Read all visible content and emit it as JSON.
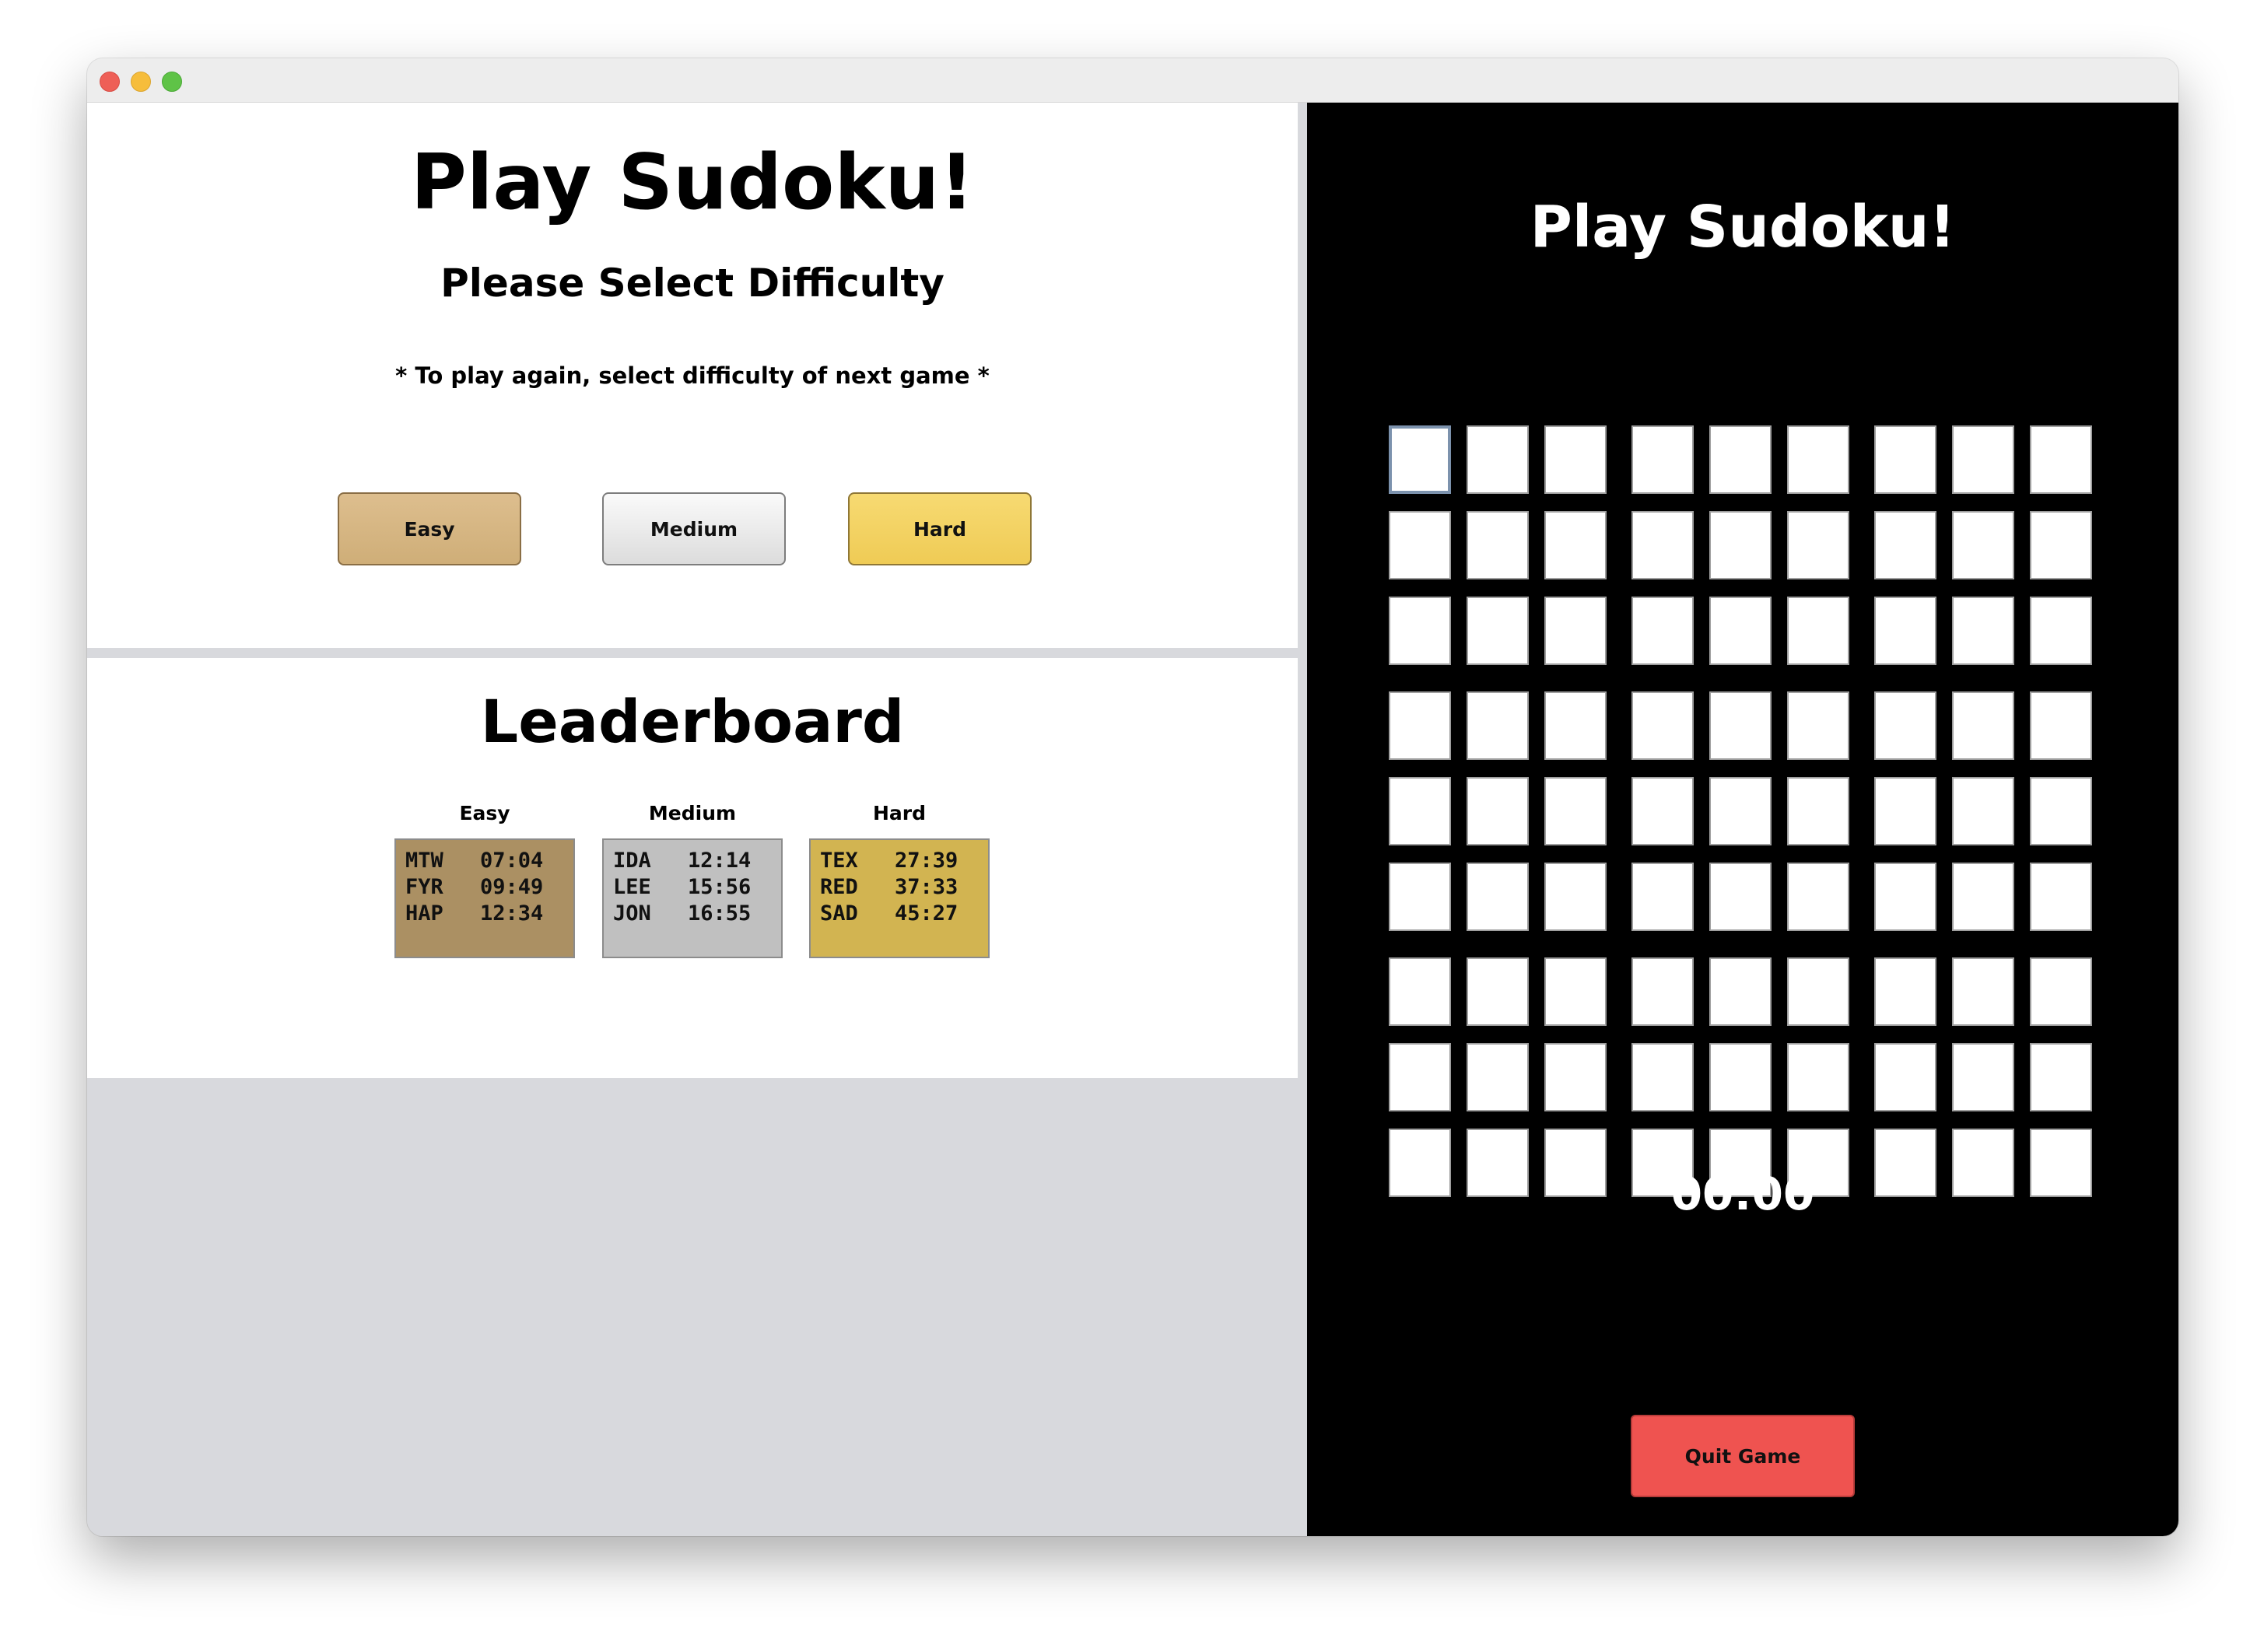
{
  "window": {
    "title": "",
    "traffic_lights": {
      "close_color": "#ee5f57",
      "minimize_color": "#f6bd3b",
      "zoom_color": "#5fc347"
    }
  },
  "menu": {
    "title": "Play Sudoku!",
    "subtitle": "Please Select Difficulty",
    "note": "* To play again, select difficulty of next game *",
    "buttons": {
      "easy": {
        "label": "Easy",
        "color": "#d4b582"
      },
      "medium": {
        "label": "Medium",
        "color": "#e6e6e6"
      },
      "hard": {
        "label": "Hard",
        "color": "#f2d060"
      }
    }
  },
  "leaderboard": {
    "title": "Leaderboard",
    "columns": [
      {
        "heading": "Easy",
        "color": "#ab9063",
        "entries": [
          {
            "name": "MTW",
            "time": "07:04"
          },
          {
            "name": "FYR",
            "time": "09:49"
          },
          {
            "name": "HAP",
            "time": "12:34"
          }
        ]
      },
      {
        "heading": "Medium",
        "color": "#c0c0c0",
        "entries": [
          {
            "name": "IDA",
            "time": "12:14"
          },
          {
            "name": "LEE",
            "time": "15:56"
          },
          {
            "name": "JON",
            "time": "16:55"
          }
        ]
      },
      {
        "heading": "Hard",
        "color": "#d2b451",
        "entries": [
          {
            "name": "TEX",
            "time": "27:39"
          },
          {
            "name": "RED",
            "time": "37:33"
          },
          {
            "name": "SAD",
            "time": "45:27"
          }
        ]
      }
    ]
  },
  "game": {
    "title": "Play Sudoku!",
    "grid_size": 9,
    "cell_values": [
      [
        "",
        "",
        "",
        "",
        "",
        "",
        "",
        "",
        ""
      ],
      [
        "",
        "",
        "",
        "",
        "",
        "",
        "",
        "",
        ""
      ],
      [
        "",
        "",
        "",
        "",
        "",
        "",
        "",
        "",
        ""
      ],
      [
        "",
        "",
        "",
        "",
        "",
        "",
        "",
        "",
        ""
      ],
      [
        "",
        "",
        "",
        "",
        "",
        "",
        "",
        "",
        ""
      ],
      [
        "",
        "",
        "",
        "",
        "",
        "",
        "",
        "",
        ""
      ],
      [
        "",
        "",
        "",
        "",
        "",
        "",
        "",
        "",
        ""
      ],
      [
        "",
        "",
        "",
        "",
        "",
        "",
        "",
        "",
        ""
      ],
      [
        "",
        "",
        "",
        "",
        "",
        "",
        "",
        "",
        ""
      ]
    ],
    "selected_cell": {
      "row": 0,
      "col": 0
    },
    "timer": "00:00",
    "quit_label": "Quit Game",
    "quit_color": "#ef5350"
  }
}
